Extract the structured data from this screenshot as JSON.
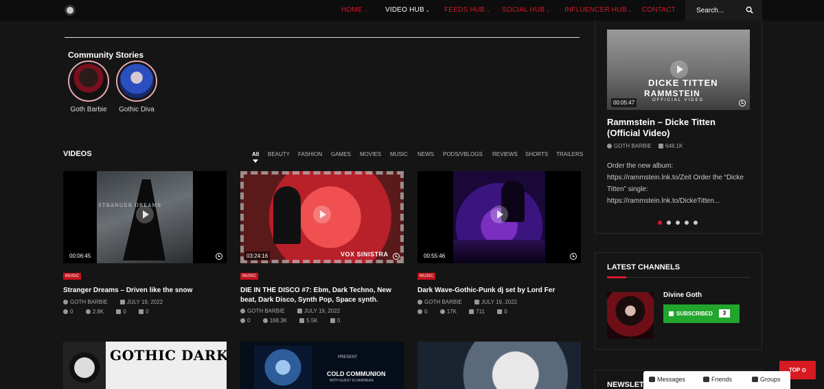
{
  "nav": {
    "items": [
      {
        "label": "HOME",
        "color": "#d7192a"
      },
      {
        "label": "VIDEO HUB",
        "color": "#ffffff"
      },
      {
        "label": "FEEDS HUB",
        "color": "#d7192a"
      },
      {
        "label": "SOCIAL HUB",
        "color": "#d7192a"
      },
      {
        "label": "INFLUENCER HUB",
        "color": "#d7192a"
      },
      {
        "label": "CONTACT",
        "color": "#d7192a"
      }
    ],
    "search_placeholder": "Search..."
  },
  "community": {
    "title": "Community Stories",
    "stories": [
      {
        "name": "Goth Barbie"
      },
      {
        "name": "Gothic Diva"
      }
    ]
  },
  "videos": {
    "title": "VIDEOS",
    "categories": [
      "All",
      "BEAUTY",
      "FASHION",
      "GAMES",
      "MOVIES",
      "MUSIC",
      "NEWS",
      "PODS/VBLOGS",
      "REVIEWS",
      "SHORTS",
      "TRAILERS"
    ],
    "items": [
      {
        "duration": "00:06:45",
        "category": "MUSIC",
        "title": "Stranger Dreams – Driven like the snow",
        "author": "GOTH BARBIE",
        "date": "JULY 19, 2022",
        "comments": "0",
        "views": "2.8K",
        "likes": "0",
        "dislikes": "0"
      },
      {
        "duration": "03:24:16",
        "category": "MUSIC",
        "title": "DIE IN THE DISCO #7: Ebm, Dark Techno, New beat, Dark Disco, Synth Pop, Space synth.",
        "author": "GOTH BARBIE",
        "date": "JULY 19, 2022",
        "comments": "0",
        "views": "168.3K",
        "likes": "5.5K",
        "dislikes": "0"
      },
      {
        "duration": "00:55:46",
        "category": "MUSIC",
        "title": "Dark Wave-Gothic-Punk dj set by Lord Fer",
        "author": "GOTH BARBIE",
        "date": "JULY 19, 2022",
        "comments": "0",
        "views": "17K",
        "likes": "711",
        "dislikes": "0"
      }
    ],
    "thumb_texts": [
      "STRANGER DREAMS",
      "VOX SINISTRA"
    ],
    "bottom_texts": [
      "GOTHIC DARKWAVE",
      "COLD COMMUNION",
      "WITH GUEST DJ ANDREAS",
      "PRESENT"
    ]
  },
  "featured": {
    "duration": "00:05:47",
    "overlay_title": "DICKE TITTEN",
    "overlay_band": "RAMMSTEIN",
    "overlay_sub": "OFFICIAL VIDEO",
    "title": "Rammstein – Dicke Titten (Official Video)",
    "author": "GOTH BARBIE",
    "likes": "648.1K",
    "description": "Order the new album: https://rammstein.lnk.to/Zeit Order the “Dicke Titten” single: https://rammstein.lnk.to/DickeTitten..."
  },
  "latest_channels": {
    "title": "LATEST CHANNELS",
    "channel_name": "Divine Goth",
    "subscribe_label": "SUBSCRIBED",
    "subscriber_count": "3"
  },
  "newsletter": {
    "title": "NEWSLETT"
  },
  "top_button": "TOP",
  "chat": {
    "messages": "Messages",
    "friends": "Friends",
    "groups": "Groups"
  }
}
